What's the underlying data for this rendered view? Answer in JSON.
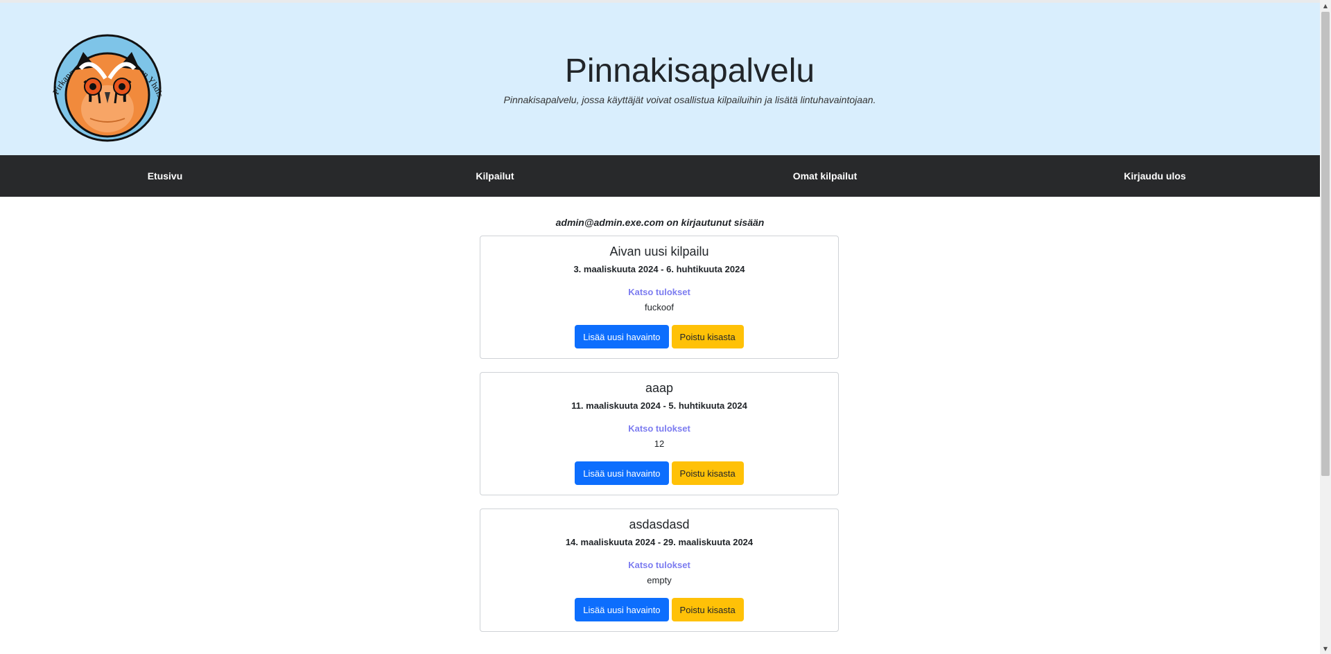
{
  "header": {
    "title": "Pinnakisapalvelu",
    "subtitle": "Pinnakisapalvelu, jossa käyttäjät voivat osallistua kilpailuihin ja lisätä lintuhavaintojaan.",
    "logo_text": "Pirkanmaan Lintutieteellinen Yhdistys ry"
  },
  "nav": {
    "items": [
      {
        "label": "Etusivu"
      },
      {
        "label": "Kilpailut"
      },
      {
        "label": "Omat kilpailut"
      },
      {
        "label": "Kirjaudu ulos"
      }
    ]
  },
  "status": {
    "logged_in_text": "admin@admin.exe.com on kirjautunut sisään"
  },
  "competitions": [
    {
      "name": "Aivan uusi kilpailu",
      "dates": "3. maaliskuuta 2024 - 6. huhtikuuta 2024",
      "results_link": "Katso tulokset",
      "note": "fuckoof",
      "add_label": "Lisää uusi havainto",
      "leave_label": "Poistu kisasta"
    },
    {
      "name": "aaap",
      "dates": "11. maaliskuuta 2024 - 5. huhtikuuta 2024",
      "results_link": "Katso tulokset",
      "note": "12",
      "add_label": "Lisää uusi havainto",
      "leave_label": "Poistu kisasta"
    },
    {
      "name": "asdasdasd",
      "dates": "14. maaliskuuta 2024 - 29. maaliskuuta 2024",
      "results_link": "Katso tulokset",
      "note": "empty",
      "add_label": "Lisää uusi havainto",
      "leave_label": "Poistu kisasta"
    }
  ],
  "colors": {
    "header_bg": "#d9eefd",
    "nav_bg": "#28292b",
    "primary": "#0d6efd",
    "warning": "#ffc107",
    "link": "#7c7cf0"
  }
}
